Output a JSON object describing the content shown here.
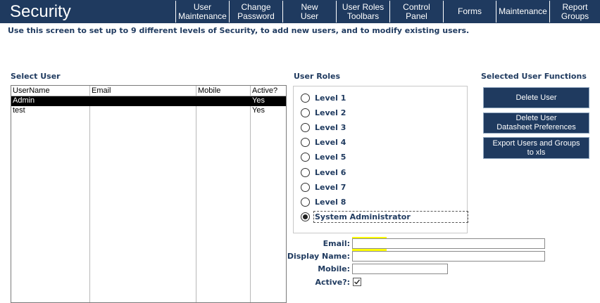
{
  "app": {
    "title": "Security"
  },
  "nav": [
    {
      "label": "User\nMaintenance"
    },
    {
      "label": "Change\nPassword"
    },
    {
      "label": "New\nUser"
    },
    {
      "label": "User Roles\nToolbars"
    },
    {
      "label": "Control\nPanel"
    },
    {
      "label": "Forms"
    },
    {
      "label": "Maintenance"
    },
    {
      "label": "Report\nGroups"
    }
  ],
  "hint": "Use this screen to set up to 9 different levels of Security, to add new users, and to modify existing users.",
  "select_user": {
    "label": "Select User",
    "columns": [
      "UserName",
      "Email",
      "Mobile",
      "Active?"
    ],
    "rows": [
      {
        "username": "Admin",
        "email": "",
        "mobile": "",
        "active": "Yes",
        "selected": true
      },
      {
        "username": "test",
        "email": "",
        "mobile": "",
        "active": "Yes",
        "selected": false
      }
    ]
  },
  "user_roles": {
    "label": "User Roles",
    "options": [
      "Level 1",
      "Level 2",
      "Level 3",
      "Level 4",
      "Level 5",
      "Level 6",
      "Level 7",
      "Level 8",
      "System Administrator"
    ],
    "selected": "System Administrator"
  },
  "functions": {
    "label": "Selected User Functions",
    "buttons": [
      "Delete User",
      "Delete User\nDatasheet Preferences",
      "Export Users and Groups\nto xls"
    ]
  },
  "fields": {
    "email": {
      "label": "Email:",
      "value": ""
    },
    "display_name": {
      "label": "Display Name:",
      "value": ""
    },
    "mobile": {
      "label": "Mobile:",
      "value": ""
    },
    "active": {
      "label": "Active?:",
      "checked": true
    }
  },
  "colors": {
    "navy": "#1f3a5f",
    "highlight": "#ffff00"
  }
}
